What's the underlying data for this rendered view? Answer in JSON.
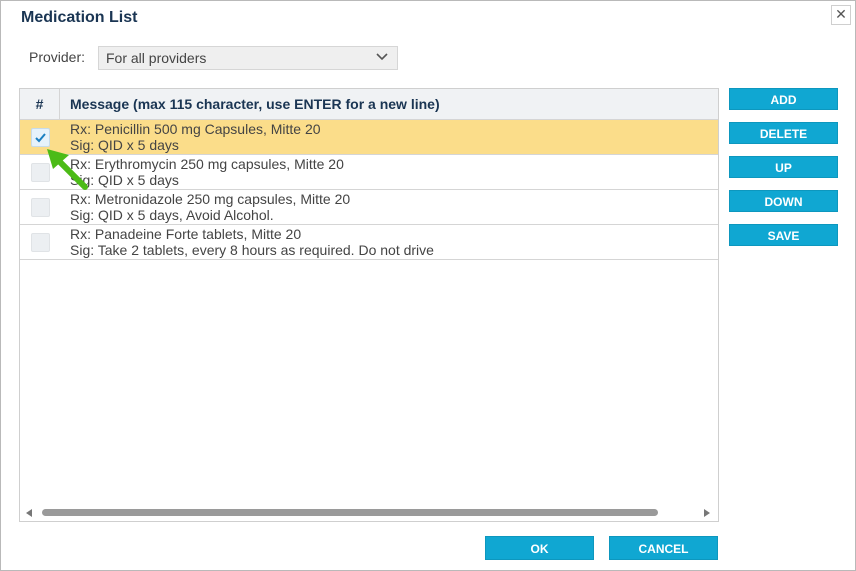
{
  "dialog": {
    "title": "Medication List",
    "close_glyph": "✕"
  },
  "provider": {
    "label": "Provider:",
    "selected": "For all providers"
  },
  "grid": {
    "header_hash": "#",
    "header_message": "Message (max 115 character, use ENTER for a new line)",
    "rows": [
      {
        "line1": "Rx: Penicillin 500 mg Capsules, Mitte 20",
        "line2": "Sig: QID x 5 days",
        "checked": true
      },
      {
        "line1": "Rx: Erythromycin 250 mg capsules, Mitte 20",
        "line2": "Sig: QID x 5 days",
        "checked": false
      },
      {
        "line1": "Rx: Metronidazole 250 mg capsules, Mitte 20",
        "line2": "Sig: QID x 5 days, Avoid Alcohol.",
        "checked": false
      },
      {
        "line1": "Rx: Panadeine Forte tablets, Mitte 20",
        "line2": "Sig: Take 2 tablets, every 8 hours as required. Do not drive",
        "checked": false
      }
    ]
  },
  "side_buttons": {
    "add": "ADD",
    "delete": "DELETE",
    "up": "UP",
    "down": "DOWN",
    "save": "SAVE"
  },
  "footer": {
    "ok": "OK",
    "cancel": "CANCEL"
  },
  "colors": {
    "accent": "#10a7d2",
    "selected_row": "#fbdd8a",
    "title": "#1a3553",
    "annotation_arrow": "#4cbb17"
  },
  "icons": {
    "close": "close-icon",
    "dropdown": "chevron-down-icon",
    "checkbox": "checkmark-icon",
    "annotation": "pointer-arrow-icon"
  }
}
